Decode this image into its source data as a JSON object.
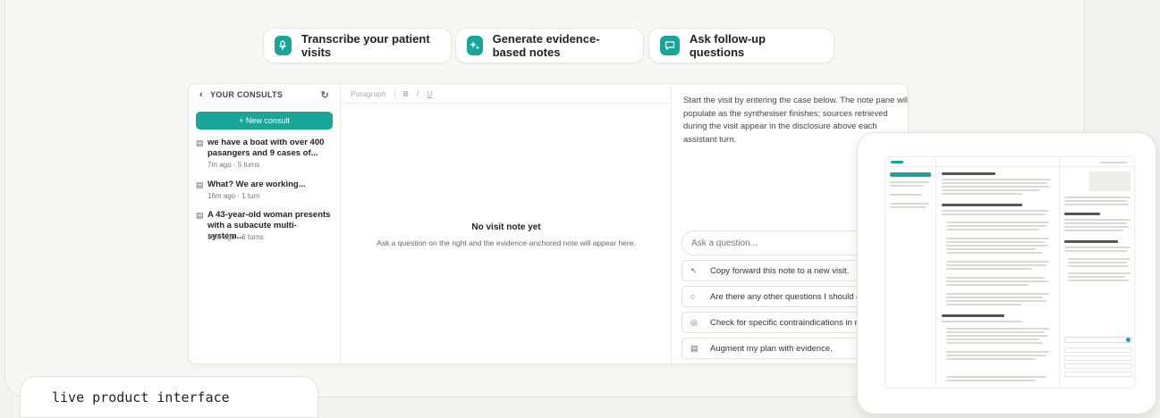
{
  "features": [
    {
      "label": "Transcribe your patient visits",
      "icon": "microphone-icon"
    },
    {
      "label": "Generate evidence-based notes",
      "icon": "sparkle-icon"
    },
    {
      "label": "Ask follow-up questions",
      "icon": "chat-bubble-icon"
    }
  ],
  "sidebar": {
    "title": "YOUR CONSULTS",
    "new_consult": "+ New consult",
    "consults": [
      {
        "title": "we have a boat with over 400 pasangers and 9 cases of...",
        "meta": "7m ago · 5 turns"
      },
      {
        "title": "What? We are working...",
        "meta": "16m ago · 1 turn"
      },
      {
        "title": "A 43-year-old woman presents with a subacute multi-system...",
        "meta": "39m ago · 6 turns"
      }
    ]
  },
  "editor": {
    "style_select": "Paragraph",
    "bold": "B",
    "italic": "I",
    "underline": "U",
    "empty_title": "No visit note yet",
    "empty_subtitle": "Ask a question on the right and the evidence-anchored note will appear here."
  },
  "assistant": {
    "intro": "Start the visit by entering the case below. The note pane will populate as the synthesiser finishes; sources retrieved during the visit appear in the disclosure above each assistant turn.",
    "ask_placeholder": "Ask a question...",
    "suggestions": [
      {
        "label": "Copy forward this note to a new visit.",
        "icon": "arrow-up-left-icon"
      },
      {
        "label": "Are there any other questions I should ask th",
        "icon": "search-icon"
      },
      {
        "label": "Check for specific contraindications in my pl",
        "icon": "pill-icon"
      },
      {
        "label": "Augment my plan with evidence.",
        "icon": "document-icon"
      }
    ]
  },
  "badge": "live product interface",
  "colors": {
    "accent": "#1aa59a",
    "background": "#f3f3f1"
  }
}
